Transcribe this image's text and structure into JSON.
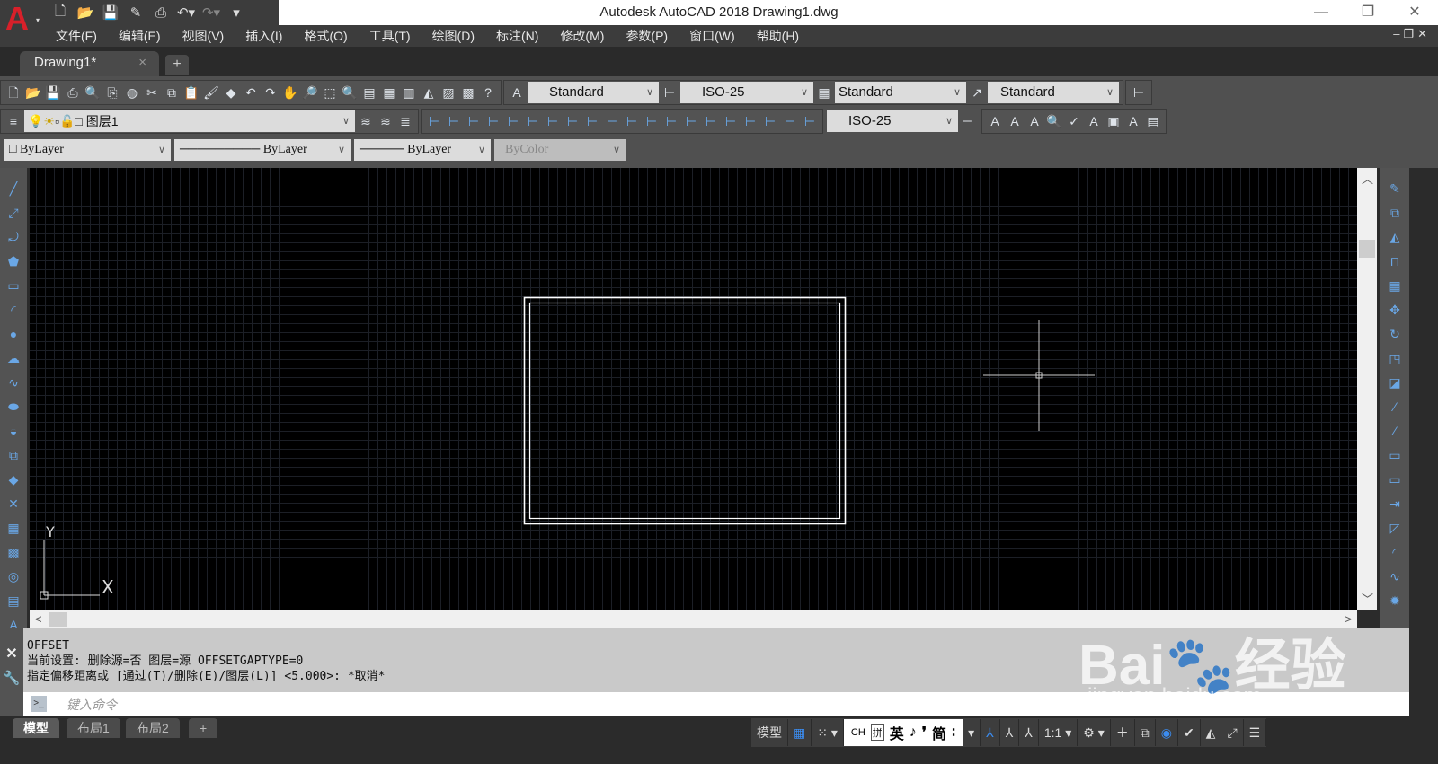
{
  "app": {
    "title": "Autodesk AutoCAD 2018    Drawing1.dwg",
    "logo": "A",
    "accent": "#d8202a"
  },
  "qat_icons": [
    "new-icon",
    "open-icon",
    "save-icon",
    "saveas-icon",
    "plot-icon",
    "undo-icon",
    "redo-icon",
    "customize-icon"
  ],
  "window": {
    "minimize": "—",
    "restore": "❐",
    "close": "✕",
    "mdi": "–❐✕"
  },
  "menu": [
    "文件(F)",
    "编辑(E)",
    "视图(V)",
    "插入(I)",
    "格式(O)",
    "工具(T)",
    "绘图(D)",
    "标注(N)",
    "修改(M)",
    "参数(P)",
    "窗口(W)",
    "帮助(H)"
  ],
  "tabs": {
    "doc": "Drawing1*",
    "close": "×",
    "new": "+"
  },
  "toolbar": {
    "std_icons": [
      "new",
      "open",
      "save",
      "plot",
      "preview",
      "publish",
      "3d",
      "cut",
      "copy",
      "paste",
      "match",
      "block",
      "undo",
      "redo",
      "pan",
      "zoom-realtime",
      "zoom-window",
      "zoom-prev",
      "properties",
      "design-center",
      "tool-palettes",
      "sheet-set",
      "markup",
      "calc",
      "help"
    ],
    "text_style": "Standard",
    "dim_style": "ISO-25",
    "table_style": "Standard",
    "mleader_style": "Standard",
    "layer": "图层1",
    "dim_style2": "ISO-25",
    "color": "ByLayer",
    "linetype": "ByLayer",
    "lineweight": "ByLayer",
    "plotstyle": "ByColor"
  },
  "command": {
    "history": [
      "OFFSET",
      "当前设置: 删除源=否  图层=源  OFFSETGAPTYPE=0",
      "指定偏移距离或 [通过(T)/删除(E)/图层(L)] <5.000>:  *取消*"
    ],
    "placeholder": "键入命令"
  },
  "layout_tabs": [
    "模型",
    "布局1",
    "布局2",
    "+"
  ],
  "status": {
    "model": "模型",
    "ime": [
      "CH",
      "拼",
      "英",
      "♪",
      "❜",
      "简",
      "∶"
    ],
    "scale": "1:1"
  },
  "ucs": {
    "x": "X",
    "y": "Y"
  },
  "watermark": {
    "brand": "Bai 经验",
    "url": "jingyan.baidu.com"
  }
}
